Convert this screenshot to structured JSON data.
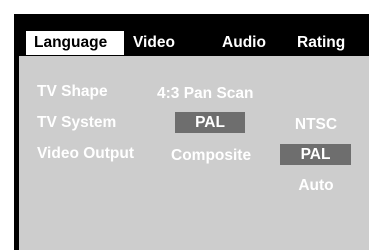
{
  "tabs": {
    "language": "Language",
    "video": "Video",
    "audio": "Audio",
    "rating": "Rating"
  },
  "rows": [
    {
      "label": "TV Shape",
      "value": "4:3 Pan Scan"
    },
    {
      "label": "TV System",
      "current": "PAL",
      "options": [
        "NTSC"
      ]
    },
    {
      "label": "Video Output",
      "current": "Composite",
      "options": [
        "PAL",
        "Auto"
      ]
    }
  ],
  "colors": {
    "screen_bg": "#000000",
    "panel_bg": "#cdcdcd",
    "selection_bg": "#6e6e6e",
    "text": "#ffffff"
  }
}
